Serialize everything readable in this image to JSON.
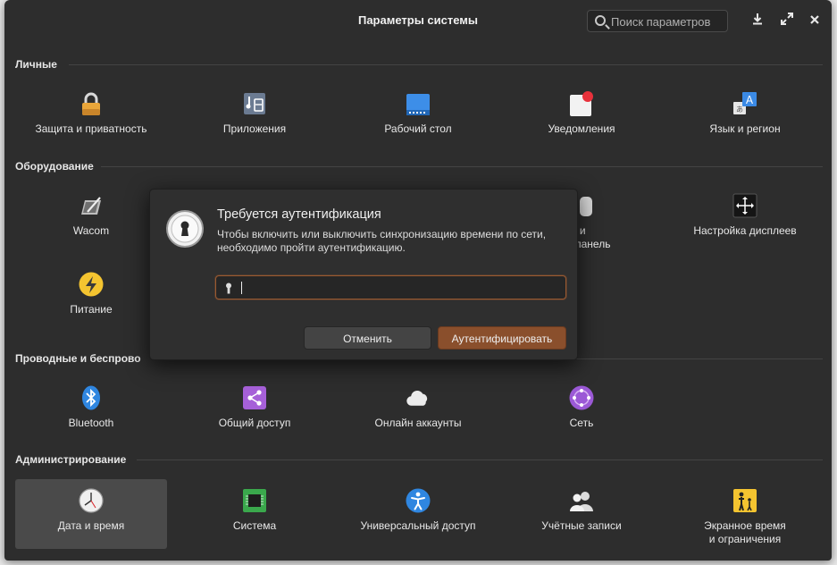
{
  "window": {
    "title": "Параметры системы",
    "search_placeholder": "Поиск параметров"
  },
  "sections": {
    "personal": "Личные",
    "hardware": "Оборудование",
    "network": "Проводные и беспроводные сети",
    "admin": "Администрирование"
  },
  "personal_items": [
    {
      "label": "Защита и приватность",
      "icon": "lock-icon"
    },
    {
      "label": "Приложения",
      "icon": "applications-icon"
    },
    {
      "label": "Рабочий стол",
      "icon": "desktop-icon"
    },
    {
      "label": "Уведомления",
      "icon": "notifications-icon"
    },
    {
      "label": "Язык и регион",
      "icon": "language-icon"
    }
  ],
  "hardware_items": [
    {
      "label": "Wacom",
      "icon": "wacom-icon"
    },
    {
      "label": "Мышь и сенсорная панель",
      "icon": "mouse-icon"
    },
    {
      "label": "Настройка дисплеев",
      "icon": "display-icon"
    },
    {
      "label": "Питание",
      "icon": "power-icon"
    }
  ],
  "hardware_partial": {
    "line1": "ышь и",
    "line2": "ная панель"
  },
  "network_items": [
    {
      "label": "Bluetooth",
      "icon": "bluetooth-icon"
    },
    {
      "label": "Общий доступ",
      "icon": "sharing-icon"
    },
    {
      "label": "Онлайн аккаунты",
      "icon": "cloud-icon"
    },
    {
      "label": "Сеть",
      "icon": "network-icon"
    }
  ],
  "admin_items": [
    {
      "label": "Дата и время",
      "icon": "clock-icon",
      "selected": true
    },
    {
      "label": "Система",
      "icon": "chip-icon"
    },
    {
      "label": "Универсальный доступ",
      "icon": "accessibility-icon"
    },
    {
      "label": "Учётные записи",
      "icon": "users-icon"
    },
    {
      "label": "Экранное время и ограничения",
      "line1": "Экранное время",
      "line2": "и ограничения",
      "icon": "parental-icon"
    }
  ],
  "network_partial_title": "Проводные и беспрово",
  "dialog": {
    "title": "Требуется аутентификация",
    "message": "Чтобы включить или выключить синхронизацию времени по сети, необходимо пройти аутентификацию.",
    "password_value": "",
    "cancel_label": "Отменить",
    "ok_label": "Аутентифицировать"
  },
  "colors": {
    "accent": "#8a4f2c",
    "window_bg": "#2d2d2d"
  }
}
